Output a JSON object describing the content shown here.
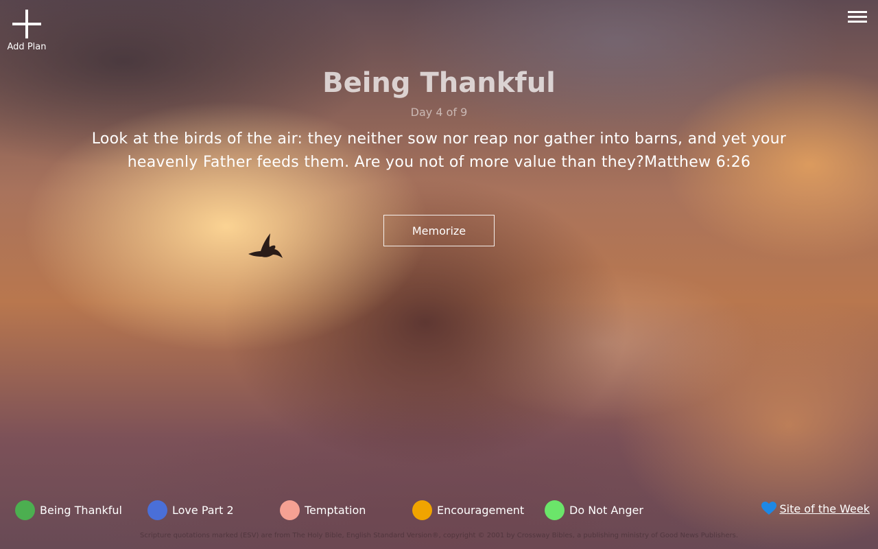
{
  "header": {
    "add_plan_label": "Add Plan",
    "add_icon": "plus-icon",
    "menu_icon": "hamburger-menu-icon"
  },
  "plan": {
    "title": "Being Thankful",
    "progress": "Day 4 of 9",
    "verse": "Look at the birds of the air: they neither sow nor reap nor gather into barns, and yet your heavenly Father feeds them. Are you not of more value than they?Matthew 6:26",
    "memorize_label": "Memorize"
  },
  "plans": [
    {
      "label": "Being Thankful",
      "color": "#4caf50"
    },
    {
      "label": "Love Part 2",
      "color": "#4a6fd8"
    },
    {
      "label": "Temptation",
      "color": "#f5a193"
    },
    {
      "label": "Encouragement",
      "color": "#f0a400"
    },
    {
      "label": "Do Not Anger",
      "color": "#6be56a"
    }
  ],
  "site_of_week": {
    "label": "Site of the Week",
    "icon": "heart-icon",
    "icon_color": "#1e88e5"
  },
  "footer": {
    "copyright": "Scripture quotations marked (ESV) are from The Holy Bible, English Standard Version®, copyright © 2001 by Crossway Bibles, a publishing ministry of Good News Publishers."
  }
}
